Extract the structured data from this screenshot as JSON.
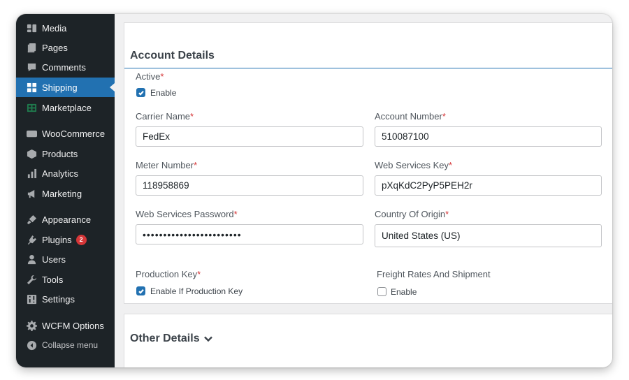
{
  "sidebar": {
    "items": [
      {
        "label": "Media",
        "icon": "media-icon"
      },
      {
        "label": "Pages",
        "icon": "pages-icon"
      },
      {
        "label": "Comments",
        "icon": "comments-icon"
      },
      {
        "label": "Shipping",
        "icon": "shipping-grid-icon",
        "active": true
      },
      {
        "label": "Marketplace",
        "icon": "marketplace-icon"
      },
      {
        "label": "WooCommerce",
        "icon": "woocommerce-icon"
      },
      {
        "label": "Products",
        "icon": "products-icon"
      },
      {
        "label": "Analytics",
        "icon": "analytics-icon"
      },
      {
        "label": "Marketing",
        "icon": "marketing-icon"
      },
      {
        "label": "Appearance",
        "icon": "appearance-icon"
      },
      {
        "label": "Plugins",
        "icon": "plugins-icon",
        "badge": "2"
      },
      {
        "label": "Users",
        "icon": "users-icon"
      },
      {
        "label": "Tools",
        "icon": "tools-icon"
      },
      {
        "label": "Settings",
        "icon": "settings-icon"
      },
      {
        "label": "WCFM Options",
        "icon": "gear-icon"
      },
      {
        "label": "Collapse menu",
        "icon": "collapse-icon"
      }
    ]
  },
  "account": {
    "title": "Account Details",
    "active_label": "Active",
    "active_checkbox_label": "Enable",
    "carrier_name_label": "Carrier Name",
    "carrier_name_value": "FedEx",
    "account_number_label": "Account Number",
    "account_number_value": "510087100",
    "meter_number_label": "Meter Number",
    "meter_number_value": "118958869",
    "web_services_key_label": "Web Services Key",
    "web_services_key_value": "pXqKdC2PyP5PEH2r",
    "web_services_password_label": "Web Services Password",
    "web_services_password_value": "••••••••••••••••••••••••",
    "country_label": "Country Of Origin",
    "country_value": "United States (US)",
    "production_key_label": "Production Key",
    "production_key_checkbox_label": "Enable If Production Key",
    "freight_label": "Freight Rates And Shipment",
    "freight_checkbox_label": "Enable",
    "required_marker": "*"
  },
  "other": {
    "title": "Other Details"
  },
  "colors": {
    "sidebar_bg": "#1d2327",
    "accent": "#2271b1",
    "required": "#d63638"
  }
}
